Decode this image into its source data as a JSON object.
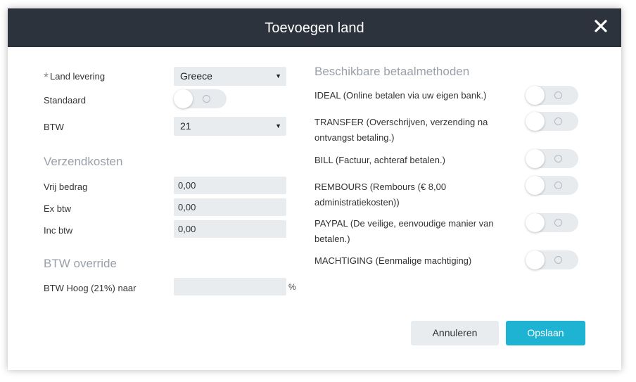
{
  "dialog": {
    "title": "Toevoegen land"
  },
  "form": {
    "required_marker": "*",
    "land_label": "Land levering",
    "land_value": "Greece",
    "standaard_label": "Standaard",
    "standaard_on": false,
    "btw_label": "BTW",
    "btw_value": "21"
  },
  "shipping": {
    "title": "Verzendkosten",
    "vrij_label": "Vrij bedrag",
    "vrij_value": "0,00",
    "ex_label": "Ex btw",
    "ex_value": "0,00",
    "inc_label": "Inc btw",
    "inc_value": "0,00"
  },
  "override": {
    "title": "BTW override",
    "hoog_label": "BTW Hoog (21%) naar",
    "hoog_value": "",
    "suffix": "%"
  },
  "payment": {
    "title": "Beschikbare betaalmethoden",
    "methods": [
      {
        "label": "IDEAL (Online betalen via uw eigen bank.)",
        "enabled": false
      },
      {
        "label": "TRANSFER (Overschrijven, verzending na ontvangst betaling.)",
        "enabled": false
      },
      {
        "label": "BILL (Factuur, achteraf betalen.)",
        "enabled": false
      },
      {
        "label": "REMBOURS (Rembours (€ 8,00 administratiekosten))",
        "enabled": false
      },
      {
        "label": "PAYPAL (De veilige, eenvoudige manier van betalen.)",
        "enabled": false
      },
      {
        "label": "MACHTIGING (Eenmalige machtiging)",
        "enabled": false
      }
    ]
  },
  "buttons": {
    "cancel": "Annuleren",
    "save": "Opslaan"
  },
  "icons": {
    "close": "close-icon",
    "dropdown": "chevron-down-icon"
  },
  "colors": {
    "header_bg": "#2c333d",
    "primary": "#1fb3d3",
    "field_bg": "#e9ecef",
    "section_title": "#9aa0a8"
  }
}
